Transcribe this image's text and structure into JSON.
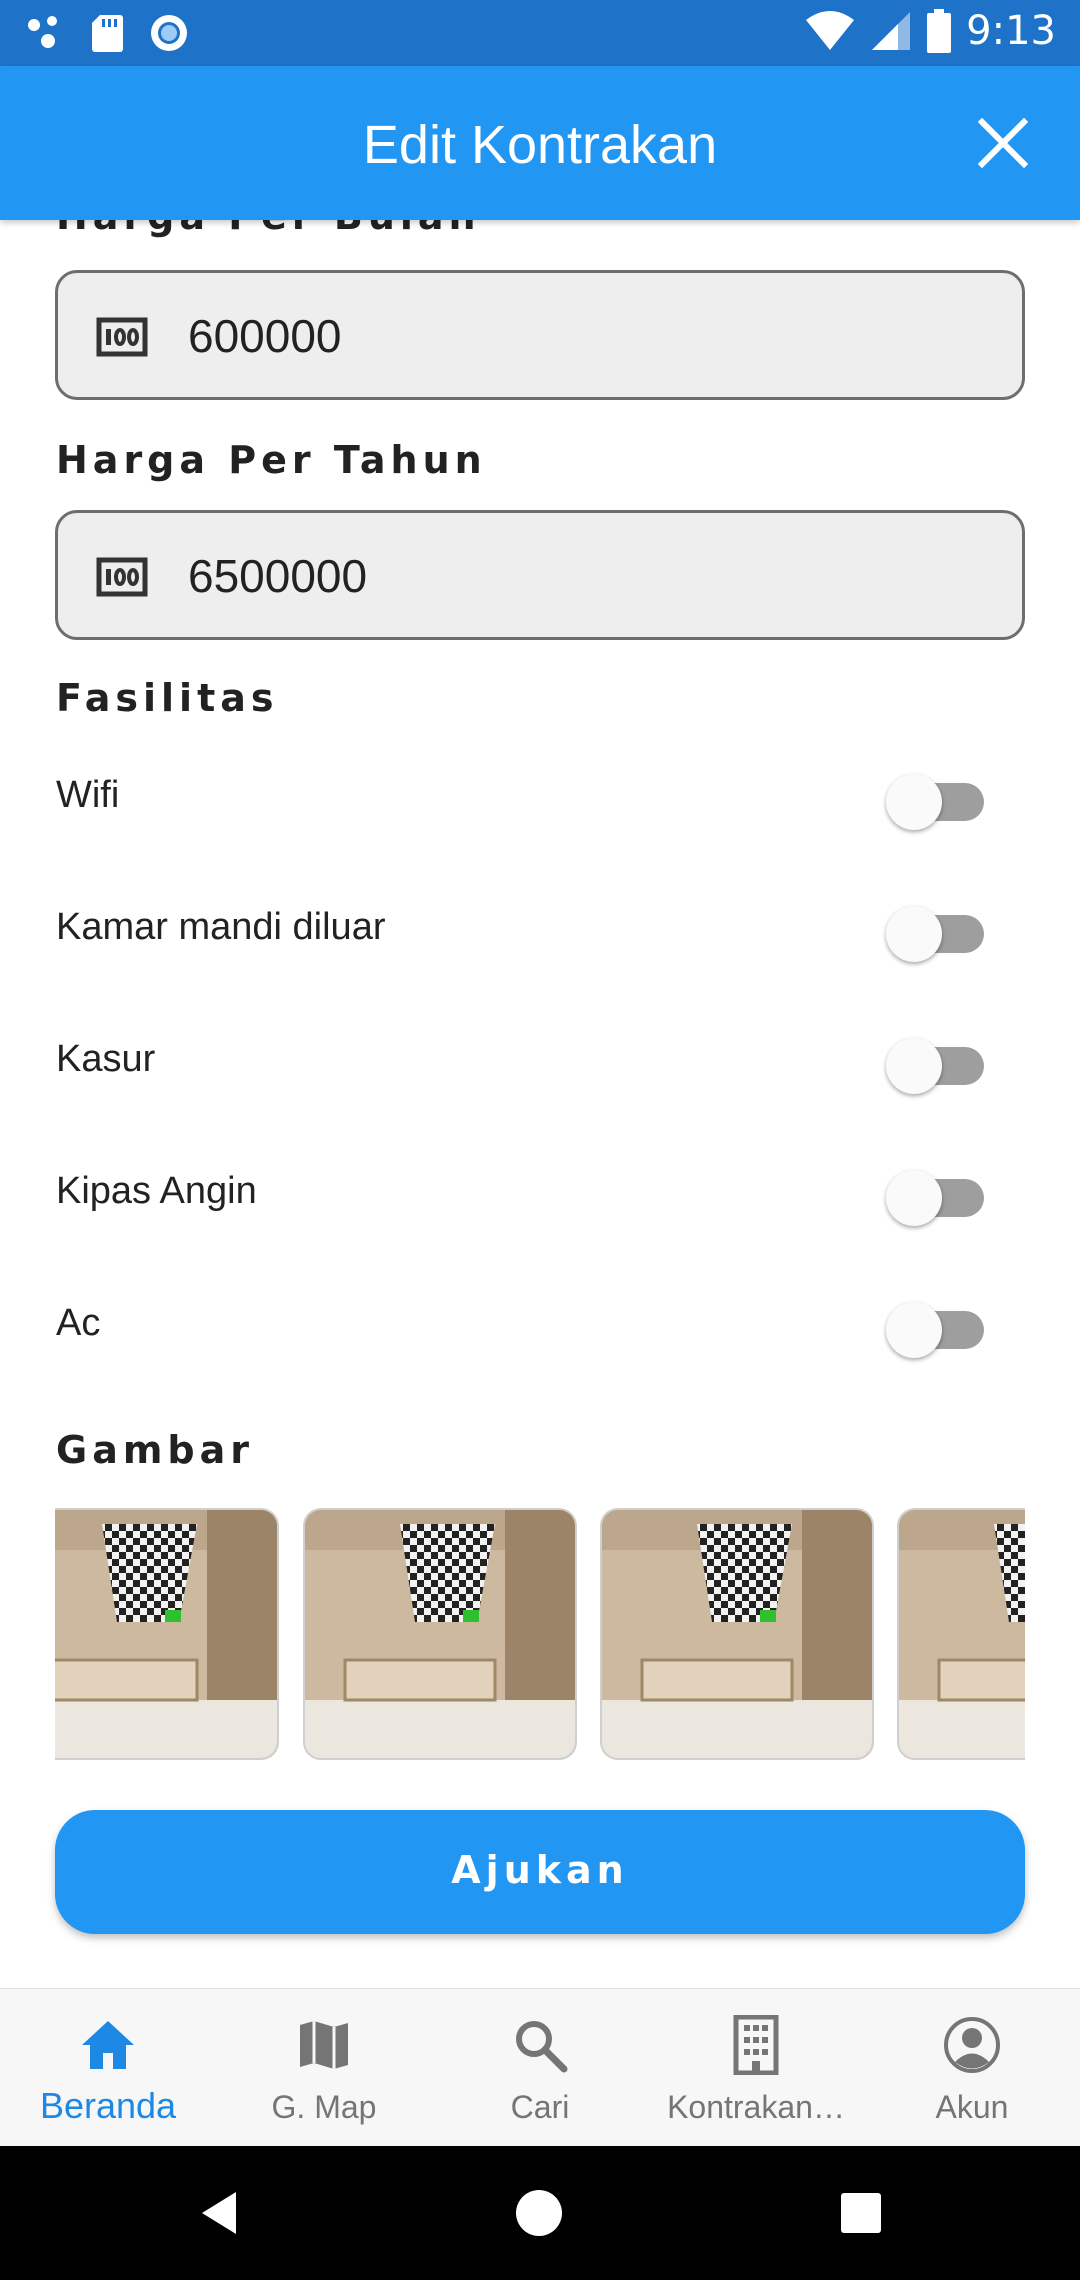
{
  "status_bar": {
    "time": "9:13"
  },
  "app_bar": {
    "title": "Edit Kontrakan"
  },
  "form": {
    "harga_bulan": {
      "label": "Harga Per Bulan",
      "value": "600000"
    },
    "harga_tahun": {
      "label": "Harga Per Tahun",
      "value": "6500000"
    },
    "fasilitas": {
      "label": "Fasilitas",
      "items": [
        {
          "label": "Wifi",
          "enabled": false
        },
        {
          "label": "Kamar mandi diluar",
          "enabled": false
        },
        {
          "label": "Kasur",
          "enabled": false
        },
        {
          "label": "Kipas Angin",
          "enabled": false
        },
        {
          "label": "Ac",
          "enabled": false
        }
      ]
    },
    "gambar": {
      "label": "Gambar"
    },
    "submit_label": "Ajukan"
  },
  "bottom_nav": {
    "items": [
      {
        "label": "Beranda",
        "icon": "home-icon",
        "active": true
      },
      {
        "label": "G. Map",
        "icon": "map-icon",
        "active": false
      },
      {
        "label": "Cari",
        "icon": "search-icon",
        "active": false
      },
      {
        "label": "Kontrakan…",
        "icon": "building-icon",
        "active": false
      },
      {
        "label": "Akun",
        "icon": "account-icon",
        "active": false
      }
    ]
  },
  "colors": {
    "primary": "#2196f3",
    "status_bar": "#1e72c8",
    "active_nav": "#1e88e5"
  }
}
